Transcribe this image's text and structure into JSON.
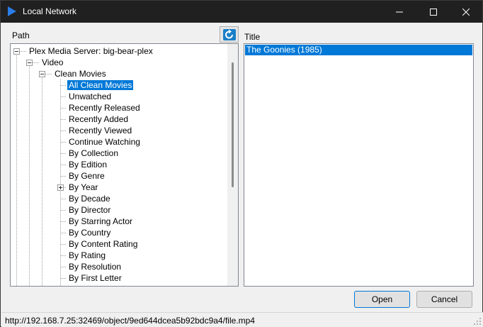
{
  "window": {
    "title": "Local Network",
    "accent_color": "#0078d7"
  },
  "labels": {
    "path": "Path",
    "title": "Title"
  },
  "tree": [
    {
      "label": "Plex Media Server: big-bear-plex",
      "level": 0,
      "expander": "minus"
    },
    {
      "label": "Video",
      "level": 1,
      "expander": "minus"
    },
    {
      "label": "Clean Movies",
      "level": 2,
      "expander": "minus"
    },
    {
      "label": "All Clean Movies",
      "level": 3,
      "selected": true
    },
    {
      "label": "Unwatched",
      "level": 3
    },
    {
      "label": "Recently Released",
      "level": 3
    },
    {
      "label": "Recently Added",
      "level": 3
    },
    {
      "label": "Recently Viewed",
      "level": 3
    },
    {
      "label": "Continue Watching",
      "level": 3
    },
    {
      "label": "By Collection",
      "level": 3
    },
    {
      "label": "By Edition",
      "level": 3
    },
    {
      "label": "By Genre",
      "level": 3
    },
    {
      "label": "By Year",
      "level": 3,
      "expander": "plus"
    },
    {
      "label": "By Decade",
      "level": 3
    },
    {
      "label": "By Director",
      "level": 3
    },
    {
      "label": "By Starring Actor",
      "level": 3
    },
    {
      "label": "By Country",
      "level": 3
    },
    {
      "label": "By Content Rating",
      "level": 3
    },
    {
      "label": "By Rating",
      "level": 3
    },
    {
      "label": "By Resolution",
      "level": 3
    },
    {
      "label": "By First Letter",
      "level": 3
    }
  ],
  "titles": [
    {
      "label": "The Goonies (1985)",
      "selected": true
    }
  ],
  "buttons": {
    "open": "Open",
    "cancel": "Cancel"
  },
  "status": {
    "url": "http://192.168.7.25:32469/object/9ed644dcea5b92bdc9a4/file.mp4"
  },
  "icons": {
    "app": "play-icon",
    "refresh": "refresh-icon"
  }
}
